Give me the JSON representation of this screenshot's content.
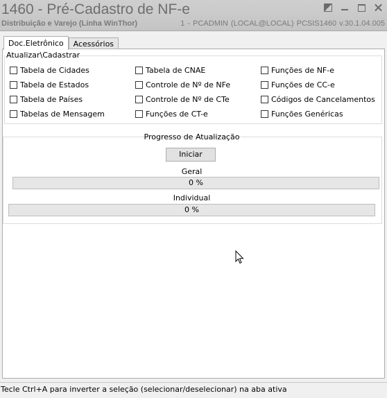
{
  "window": {
    "title": "1460 - Pré-Cadastro de NF-e",
    "subtitle": "Distribuição e Varejo (Linha WinThor)",
    "session_info": "1 - PCADMIN (LOCAL@LOCAL)   PCSIS1460  v.30.1.04.005"
  },
  "tabs": [
    {
      "label": "Doc.Eletrônico",
      "active": true
    },
    {
      "label": "Acessórios",
      "active": false
    }
  ],
  "group": {
    "title": "Atualizar\\Cadastrar",
    "checkboxes": [
      {
        "label": "Tabela de Cidades",
        "checked": false
      },
      {
        "label": "Tabela de Estados",
        "checked": false
      },
      {
        "label": "Tabela de Países",
        "checked": false
      },
      {
        "label": "Tabelas de Mensagem",
        "checked": false
      },
      {
        "label": "Tabela de CNAE",
        "checked": false
      },
      {
        "label": "Controle de Nº de NFe",
        "checked": false
      },
      {
        "label": "Controle de Nº de CTe",
        "checked": false
      },
      {
        "label": "Funções de CT-e",
        "checked": false
      },
      {
        "label": "Funções de NF-e",
        "checked": false
      },
      {
        "label": "Funções de CC-e",
        "checked": false
      },
      {
        "label": "Códigos de Cancelamentos",
        "checked": false
      },
      {
        "label": "Funções Genéricas",
        "checked": false
      }
    ]
  },
  "progress": {
    "title": "Progresso de Atualização",
    "start_button": "Iniciar",
    "general_label": "Geral",
    "general_value": 0,
    "general_text": "0 %",
    "individual_label": "Individual",
    "individual_value": 0,
    "individual_text": "0 %"
  },
  "status_bar": "Tecle Ctrl+A para inverter a seleção (selecionar/deselecionar) na aba ativa"
}
